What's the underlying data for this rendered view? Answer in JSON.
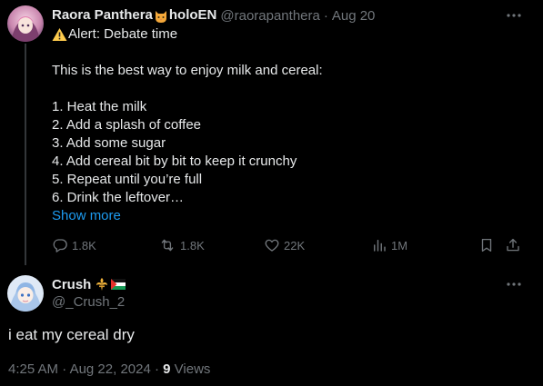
{
  "parent_tweet": {
    "author_name_prefix": "Raora Panthera",
    "author_name_suffix": "holoEN",
    "author_emoji_icon": "cat-face-icon",
    "handle": "@raorapanthera",
    "separator": "·",
    "date": "Aug 20",
    "alert_icon": "warning-icon",
    "text_lines": [
      "Alert: Debate time",
      "",
      "This is the best way to enjoy milk and cereal:",
      "",
      "1. Heat the milk",
      "2. Add a splash of coffee",
      "3. Add some sugar",
      "4. Add cereal bit by bit to keep it crunchy",
      "5. Repeat until you’re full",
      "6. Drink the leftover…"
    ],
    "show_more": "Show more",
    "actions": {
      "replies": "1.8K",
      "reposts": "1.8K",
      "likes": "22K",
      "views": "1M"
    }
  },
  "reply_tweet": {
    "author_name": "Crush",
    "badge_icon": "fleur-de-lis-badge-icon",
    "flag_icon": "palestine-flag-icon",
    "handle": "@_Crush_2",
    "text": "i eat my cereal dry",
    "time": "4:25 AM",
    "separator": "·",
    "date": "Aug 22, 2024",
    "views_count": "9",
    "views_label": "Views"
  },
  "colors": {
    "background": "#000000",
    "text_primary": "#e7e9ea",
    "text_muted": "#71767b",
    "link": "#1d9bf0",
    "thread_line": "#333639"
  }
}
